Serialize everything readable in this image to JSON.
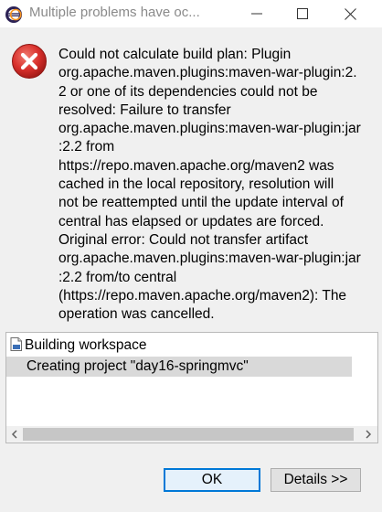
{
  "window": {
    "title": "Multiple problems have oc..."
  },
  "icons": {
    "app": "eclipse-icon",
    "error": "error-icon",
    "job": "job-icon"
  },
  "message": {
    "lines": [
      "Could not calculate build plan: Plugin",
      "org.apache.maven.plugins:maven-war-plugin:2.",
      "2 or one of its dependencies could not be",
      "resolved: Failure to transfer",
      "org.apache.maven.plugins:maven-war-plugin:jar",
      ":2.2 from",
      "https://repo.maven.apache.org/maven2 was",
      "cached in the local repository, resolution will",
      "not be reattempted until the update interval of",
      "central has elapsed or updates are forced.",
      "Original error: Could not transfer artifact",
      "org.apache.maven.plugins:maven-war-plugin:jar",
      ":2.2 from/to central",
      "(https://repo.maven.apache.org/maven2): The",
      "operation was cancelled."
    ]
  },
  "details": {
    "items": [
      "Building workspace",
      "Creating project \"day16-springmvc\""
    ]
  },
  "buttons": {
    "ok": "OK",
    "details": "Details >>"
  },
  "colors": {
    "error_red": "#d9302c",
    "focus_blue": "#0078d7",
    "selection": "#d9d9d9"
  }
}
